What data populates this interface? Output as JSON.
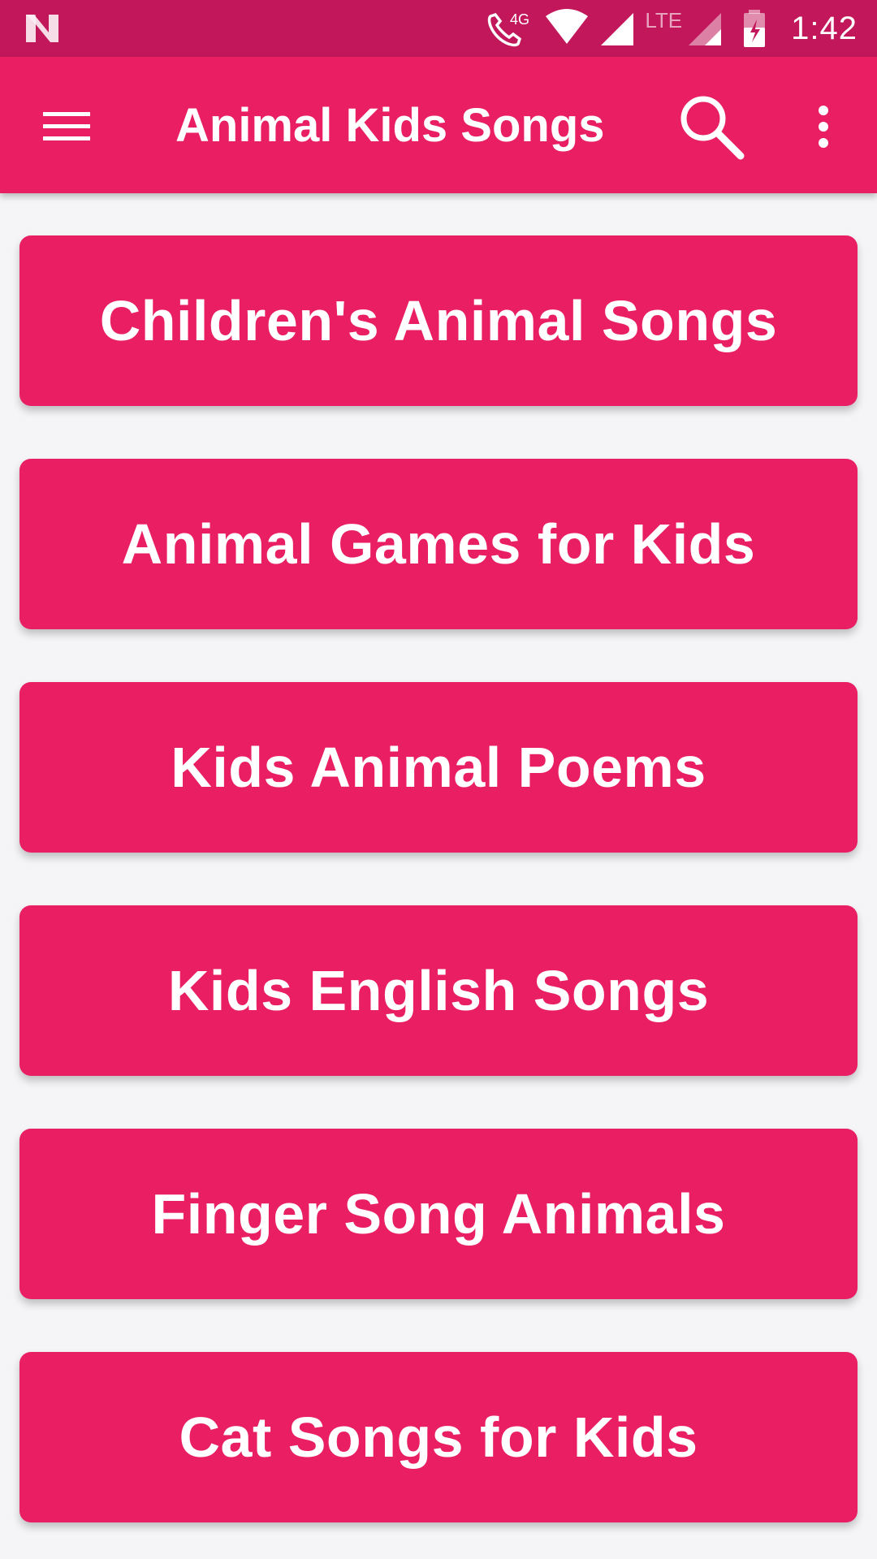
{
  "status_bar": {
    "time": "1:42",
    "network_label": "4G",
    "lte_label": "LTE",
    "icons": [
      "n-logo-icon",
      "wifi-call-icon",
      "wifi-icon",
      "signal-icon",
      "signal-icon",
      "battery-charging-icon"
    ]
  },
  "app_bar": {
    "title": "Animal Kids Songs",
    "menu_icon": "hamburger-menu-icon",
    "search_icon": "search-icon",
    "more_icon": "more-vert-icon"
  },
  "categories": [
    {
      "label": "Children's Animal Songs"
    },
    {
      "label": "Animal Games for Kids"
    },
    {
      "label": "Kids Animal Poems"
    },
    {
      "label": "Kids English Songs"
    },
    {
      "label": "Finger Song Animals"
    },
    {
      "label": "Cat Songs for Kids"
    }
  ],
  "colors": {
    "status_bar": "#c2185b",
    "primary": "#e91e63",
    "background": "#f5f5f7",
    "text": "#ffffff"
  }
}
